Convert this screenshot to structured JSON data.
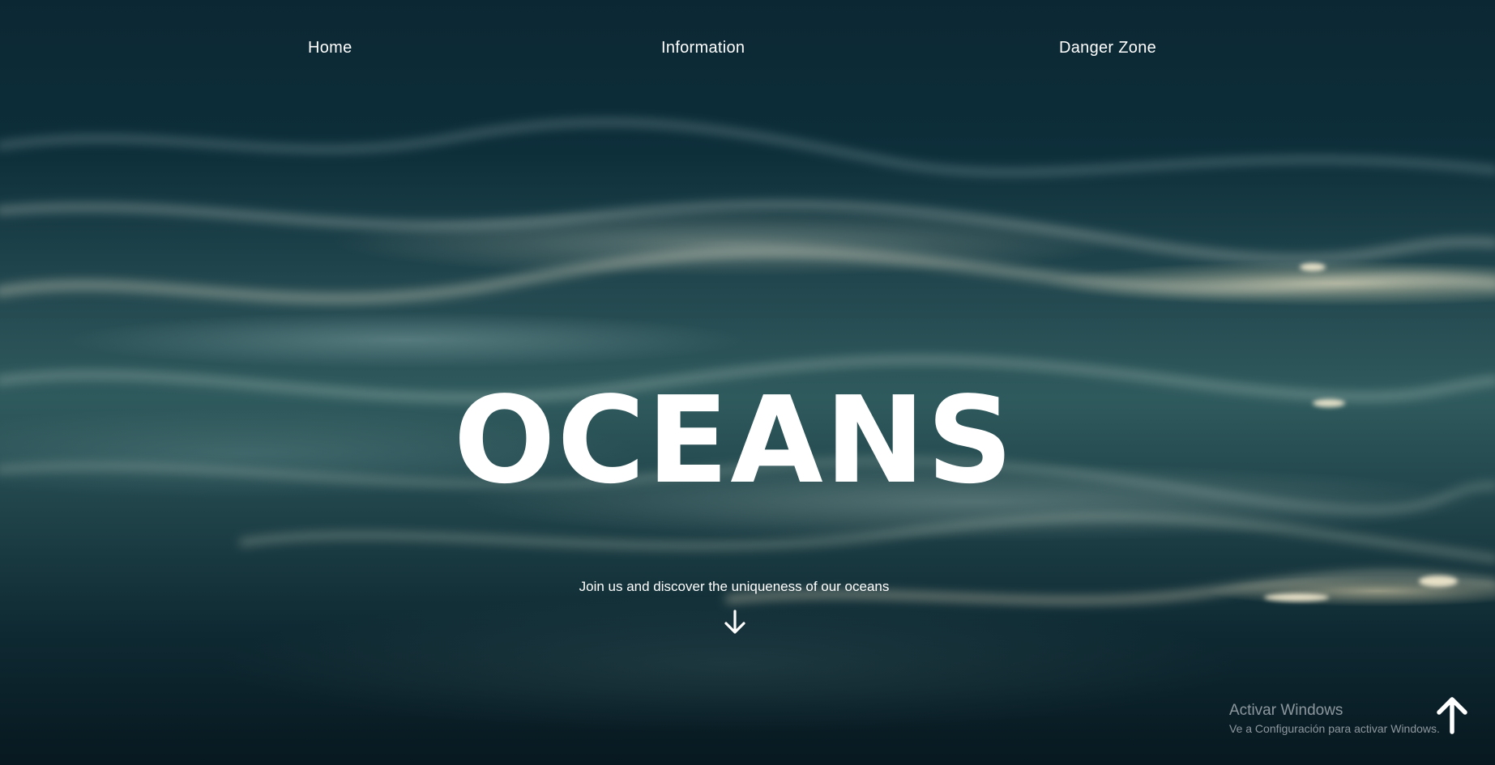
{
  "nav": {
    "items": [
      {
        "label": "Home"
      },
      {
        "label": "Information"
      },
      {
        "label": "Danger Zone"
      }
    ]
  },
  "hero": {
    "title": "OCEANS",
    "subtitle": "Join us and discover the uniqueness of our oceans",
    "scroll_down_icon": "arrow-down-icon"
  },
  "back_to_top_icon": "arrow-up-icon",
  "windows_activation": {
    "title": "Activar Windows",
    "subtitle": "Ve a Configuración para activar Windows."
  },
  "colors": {
    "text": "#ffffff",
    "water_dark": "#0b2733",
    "water_mid": "#2f5a5d",
    "highlight": "#f2e6c4"
  }
}
